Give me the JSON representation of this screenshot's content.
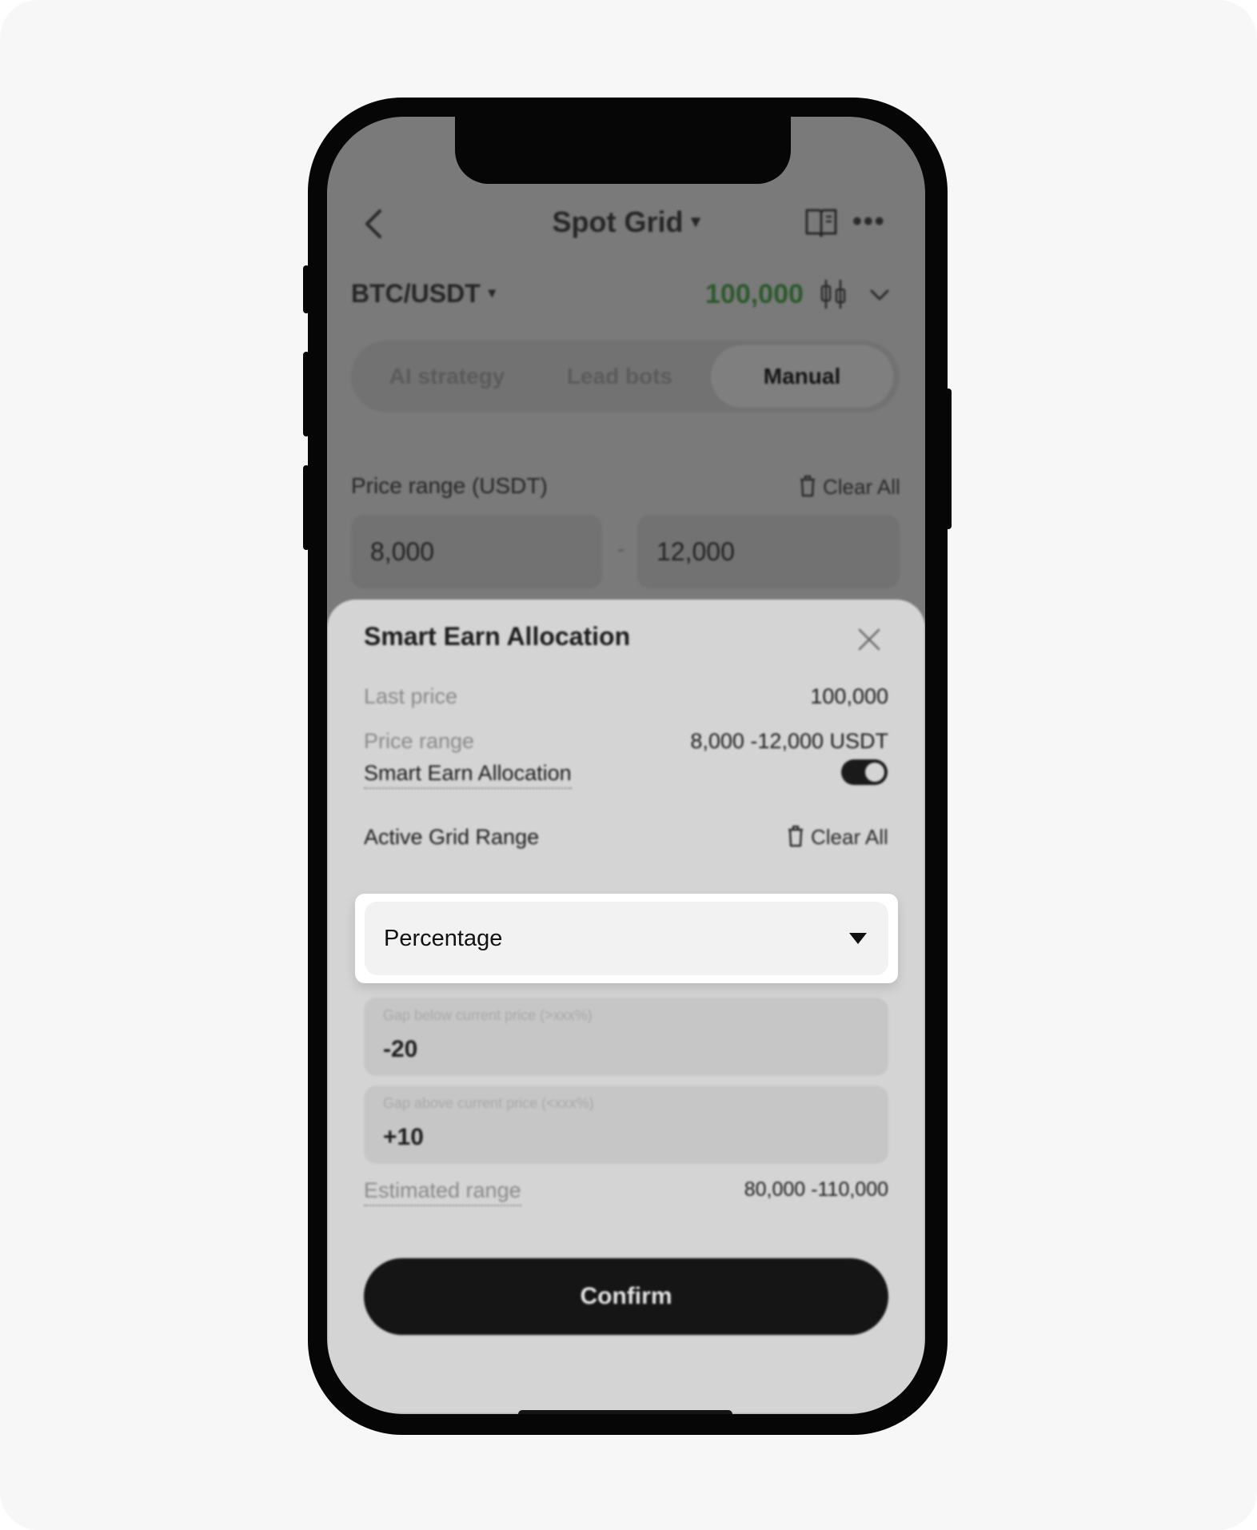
{
  "nav": {
    "title": "Spot Grid",
    "title_caret": "▾",
    "back_icon": "chevron-left-icon",
    "book_icon": "book-icon",
    "more_icon": "more-icon",
    "more_glyph": "•••"
  },
  "pair": {
    "symbol": "BTC/USDT",
    "caret": "▾",
    "price": "100,000",
    "price_color": "#2c5a2c"
  },
  "tabs": [
    {
      "label": "AI strategy",
      "active": false
    },
    {
      "label": "Lead bots",
      "active": false
    },
    {
      "label": "Manual",
      "active": true
    }
  ],
  "price_range": {
    "label": "Price range (USDT)",
    "clear_label": "Clear All",
    "min": "8,000",
    "max": "12,000",
    "separator": "-"
  },
  "sheet": {
    "title": "Smart Earn Allocation",
    "last_price_label": "Last price",
    "last_price_value": "100,000",
    "range_label": "Price range",
    "range_value": "8,000 -12,000 USDT",
    "toggle_label": "Smart Earn Allocation",
    "toggle_on": true,
    "active_grid_label": "Active Grid Range",
    "clear_label": "Clear All",
    "dropdown_value": "Percentage",
    "gap_below_placeholder": "Gap below current price (>xxx%)",
    "gap_below_value": "-20",
    "gap_above_placeholder": "Gap above current price (<xxx%)",
    "gap_above_value": "+10",
    "estimated_label": "Estimated range",
    "estimated_value": "80,000 -110,000",
    "confirm_label": "Confirm"
  }
}
